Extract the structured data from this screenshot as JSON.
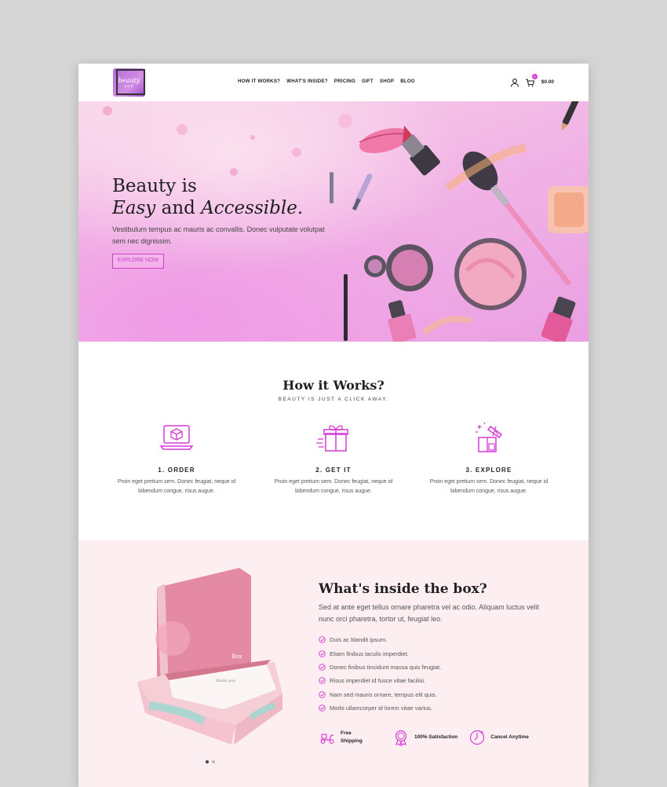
{
  "brand": {
    "logo_text": "beauty",
    "logo_sub": "BOX"
  },
  "nav": {
    "items": [
      "HOW IT WORKS?",
      "WHAT'S INSIDE?",
      "PRICING",
      "GIFT",
      "SHOP",
      "BLOG"
    ]
  },
  "header": {
    "cart_count": "0",
    "cart_total": "$0.00"
  },
  "hero": {
    "title_line1": "Beauty is",
    "title_word_easy": "Easy",
    "title_and": " and ",
    "title_word_accessible": "Accessible.",
    "text": "Vestibulum tempus ac mauris ac convallis. Donec vulputate volutpat sem nec dignissim.",
    "button": "EXPLORE NOW"
  },
  "how": {
    "title": "How it Works?",
    "subtitle": "BEAUTY IS JUST A CLICK AWAY.",
    "steps": [
      {
        "title": "1. ORDER",
        "text": "Proin eget pretium sem. Donec feugiat, neque id bibendum congue, risus augue."
      },
      {
        "title": "2. GET IT",
        "text": "Proin eget pretium sem. Donec feugiat, neque id bibendum congue, risus augue."
      },
      {
        "title": "3. EXPLORE",
        "text": "Proin eget pretium sem. Donec feugiat, neque id bibendum congue, risus augue."
      }
    ]
  },
  "inside": {
    "title": "What's inside the box?",
    "text": "Sed at ante eget tellus ornare pharetra vel ac odio. Aliquam luctus velit nunc orci pharetra, tortor ut, feugiat leo.",
    "list": [
      "Duis ac blandit ipsum.",
      "Etiam finibus iaculis imperdiet.",
      "Donec finibus tincidunt massa quis feugiat.",
      "Risus imperdiet id fusce vitae facilisi.",
      "Nam sed mauris ornare, tempus elit quis.",
      "Morbi ullamcorper id lorem vitae varius."
    ],
    "features": [
      "Free Shipping",
      "100% Satisfaction",
      "Cancel Anytime"
    ],
    "box_brand": "Box",
    "box_card": "thank you"
  },
  "colors": {
    "accent": "#d23fd0",
    "icon": "#d63ad6",
    "section_bg": "#fdeef1"
  }
}
